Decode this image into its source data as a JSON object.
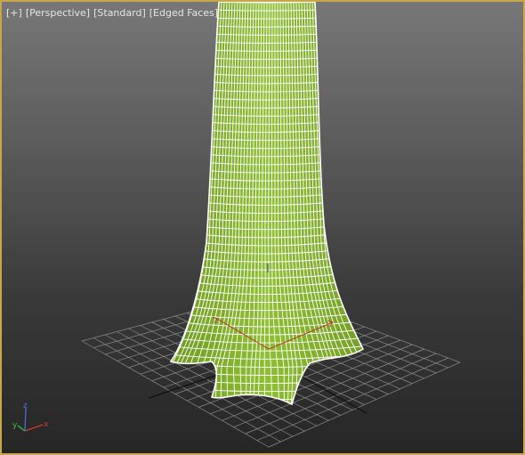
{
  "viewport": {
    "labels": [
      "[+]",
      "[Perspective]",
      "[Standard]",
      "[Edged Faces]"
    ],
    "border_color": "#c8a74a",
    "active": true
  },
  "scene": {
    "object": "cloth-column",
    "mesh_color": "#8fbf34",
    "wire_color": "#ffffff",
    "grid_color": "#8a8a8a"
  },
  "axis_tripod": {
    "x_label": "x",
    "y_label": "y",
    "z_label": "z",
    "x_color": "#d23b2b",
    "y_color": "#3cc33c",
    "z_color": "#4a72e8"
  }
}
